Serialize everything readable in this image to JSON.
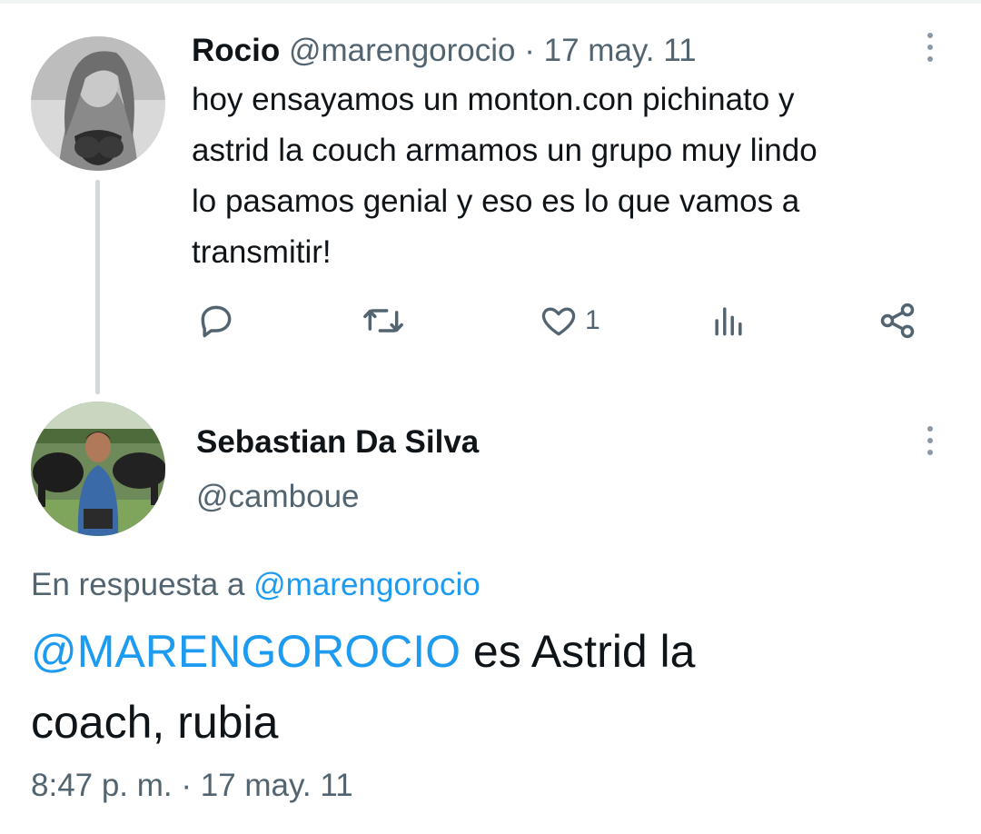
{
  "tweet1": {
    "name": "Rocio",
    "handle": "@marengorocio",
    "separator": " · ",
    "date": "17 may. 11",
    "text_lines": [
      "hoy ensayamos un monton.con pichinato y",
      "astrid la couch armamos un grupo muy lindo",
      "lo pasamos genial y eso es lo que vamos a",
      "transmitir!"
    ],
    "actions": {
      "reply_icon": "reply-icon",
      "retweet_icon": "retweet-icon",
      "like_icon": "heart-icon",
      "like_count": "1",
      "views_icon": "analytics-icon",
      "share_icon": "share-icon"
    }
  },
  "tweet2": {
    "name": "Sebastian Da Silva",
    "handle": "@camboue",
    "reply_prefix": "En respuesta a ",
    "reply_target": "@marengorocio",
    "mention": "@MARENGOROCIO",
    "text_rest": " es Astrid la",
    "text_line2": "coach, rubia",
    "timestamp": "8:47 p. m. · 17 may. 11"
  },
  "colors": {
    "link": "#1d9bf0",
    "text_primary": "#0f1419",
    "text_secondary": "#536471",
    "thread_line": "#cfd9de"
  }
}
